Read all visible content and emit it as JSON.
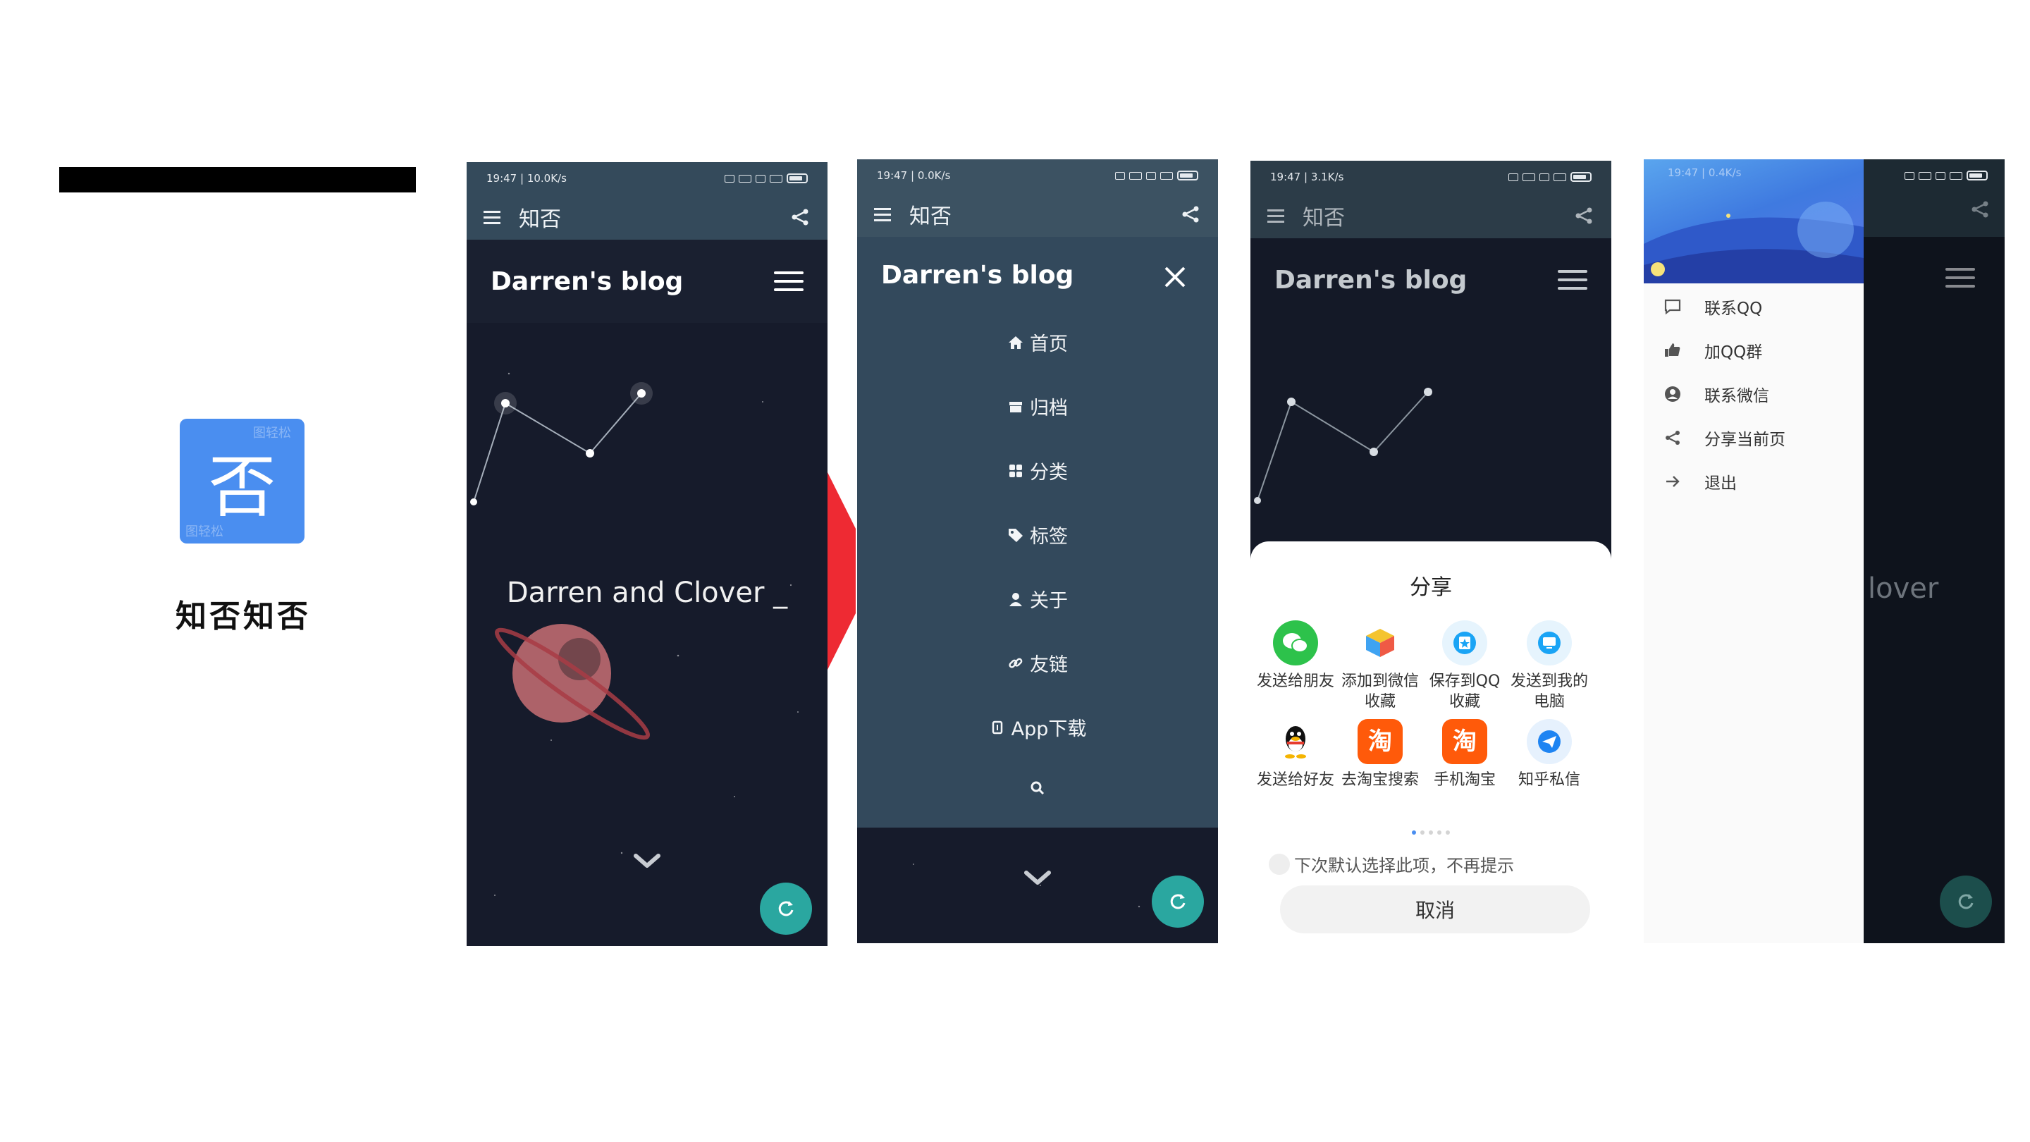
{
  "intro": {
    "app_icon_char": "否",
    "app_icon_watermark": "图轻松",
    "caption": "知否知否"
  },
  "phone1": {
    "status_time": "19:47 | 10.0K/s",
    "appbar_title": "知否",
    "blog_title": "Darren's blog",
    "hero_text": "Darren and Clover _",
    "fab_icon": "refresh-icon"
  },
  "phone2": {
    "status_time": "19:47 | 0.0K/s",
    "appbar_title": "知否",
    "blog_title": "Darren's blog",
    "nav_items": [
      {
        "icon": "home-icon",
        "label": "首页"
      },
      {
        "icon": "archive-icon",
        "label": "归档"
      },
      {
        "icon": "category-icon",
        "label": "分类"
      },
      {
        "icon": "tag-icon",
        "label": "标签"
      },
      {
        "icon": "user-icon",
        "label": "关于"
      },
      {
        "icon": "link-icon",
        "label": "友链"
      },
      {
        "icon": "download-icon",
        "label": "App下载"
      },
      {
        "icon": "search-icon",
        "label": ""
      }
    ]
  },
  "phone3": {
    "status_time": "19:47 | 3.1K/s",
    "appbar_title": "知否",
    "blog_title": "Darren's blog",
    "sheet_title": "分享",
    "share_targets": [
      {
        "label": "发送给朋友",
        "color": "#2dc24b",
        "icon": "wechat-icon"
      },
      {
        "label": "添加到微信收藏",
        "color": "#ffffff",
        "icon": "cube-icon"
      },
      {
        "label": "保存到QQ收藏",
        "color": "#1aa4f5",
        "icon": "qq-favorite-icon"
      },
      {
        "label": "发送到我的电脑",
        "color": "#1aa4f5",
        "icon": "computer-icon"
      },
      {
        "label": "发送给好友",
        "color": "#ffffff",
        "icon": "qq-penguin-icon"
      },
      {
        "label": "去淘宝搜索",
        "color": "#ff5a0a",
        "icon": "taobao-icon"
      },
      {
        "label": "手机淘宝",
        "color": "#ff5a0a",
        "icon": "taobao-icon"
      },
      {
        "label": "知乎私信",
        "color": "#1e84f2",
        "icon": "zhihu-icon"
      }
    ],
    "remember_text": "下次默认选择此项，不再提示",
    "cancel_label": "取消"
  },
  "phone4": {
    "status_time": "19:47 | 0.4K/s",
    "drawer_items": [
      {
        "icon": "message-icon",
        "label": "联系QQ"
      },
      {
        "icon": "thumb-up-icon",
        "label": "加QQ群"
      },
      {
        "icon": "account-icon",
        "label": "联系微信"
      },
      {
        "icon": "share-icon",
        "label": "分享当前页"
      },
      {
        "icon": "arrow-right-icon",
        "label": "退出"
      }
    ],
    "hero_text_partial": "lover"
  }
}
